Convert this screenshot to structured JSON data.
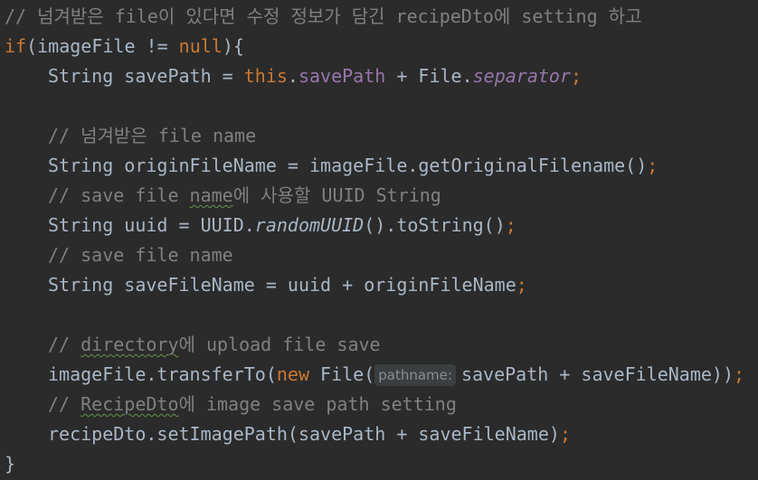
{
  "code": {
    "comment_setting": "// 넘겨받은 file이 있다면 수정 정보가 담긴 recipeDto에 setting 하고",
    "kw_if": "if",
    "if_open": "(imageFile != ",
    "kw_null": "null",
    "if_close": "){",
    "sp_decl": "String savePath = ",
    "kw_this": "this",
    "dot": ".",
    "fld_savePath": "savePath",
    "sp_plus": " + File.",
    "sfi_separator": "separator",
    "semi": ";",
    "comment_file_name": "// 넘겨받은 file name",
    "origin_line": "String originFileName = imageFile.getOriginalFilename()",
    "comment_save_prefix": "// save file ",
    "comment_save_name": "name",
    "comment_save_suffix": "에 사용할 UUID String",
    "uuid_prefix": "String uuid = UUID.",
    "uuid_method": "randomUUID",
    "uuid_suffix": "().toString()",
    "comment_save_file_name": "// save file name",
    "savefile_line": "String saveFileName = uuid + originFileName",
    "comment_dir_prefix": "// ",
    "comment_dir_word": "directory",
    "comment_dir_suffix": "에 upload file save",
    "transfer_prefix": "imageFile.transferTo(",
    "kw_new": "new",
    "file_ctor": " File(",
    "hint_pathname": "pathname:",
    "transfer_args": "savePath + saveFileName))",
    "comment_recipe_prefix": "// ",
    "comment_recipe_word": "RecipeDto",
    "comment_recipe_suffix": "에 image save path setting",
    "setpath_line": "recipeDto.setImagePath(savePath + saveFileName)",
    "close_brace": "}"
  }
}
